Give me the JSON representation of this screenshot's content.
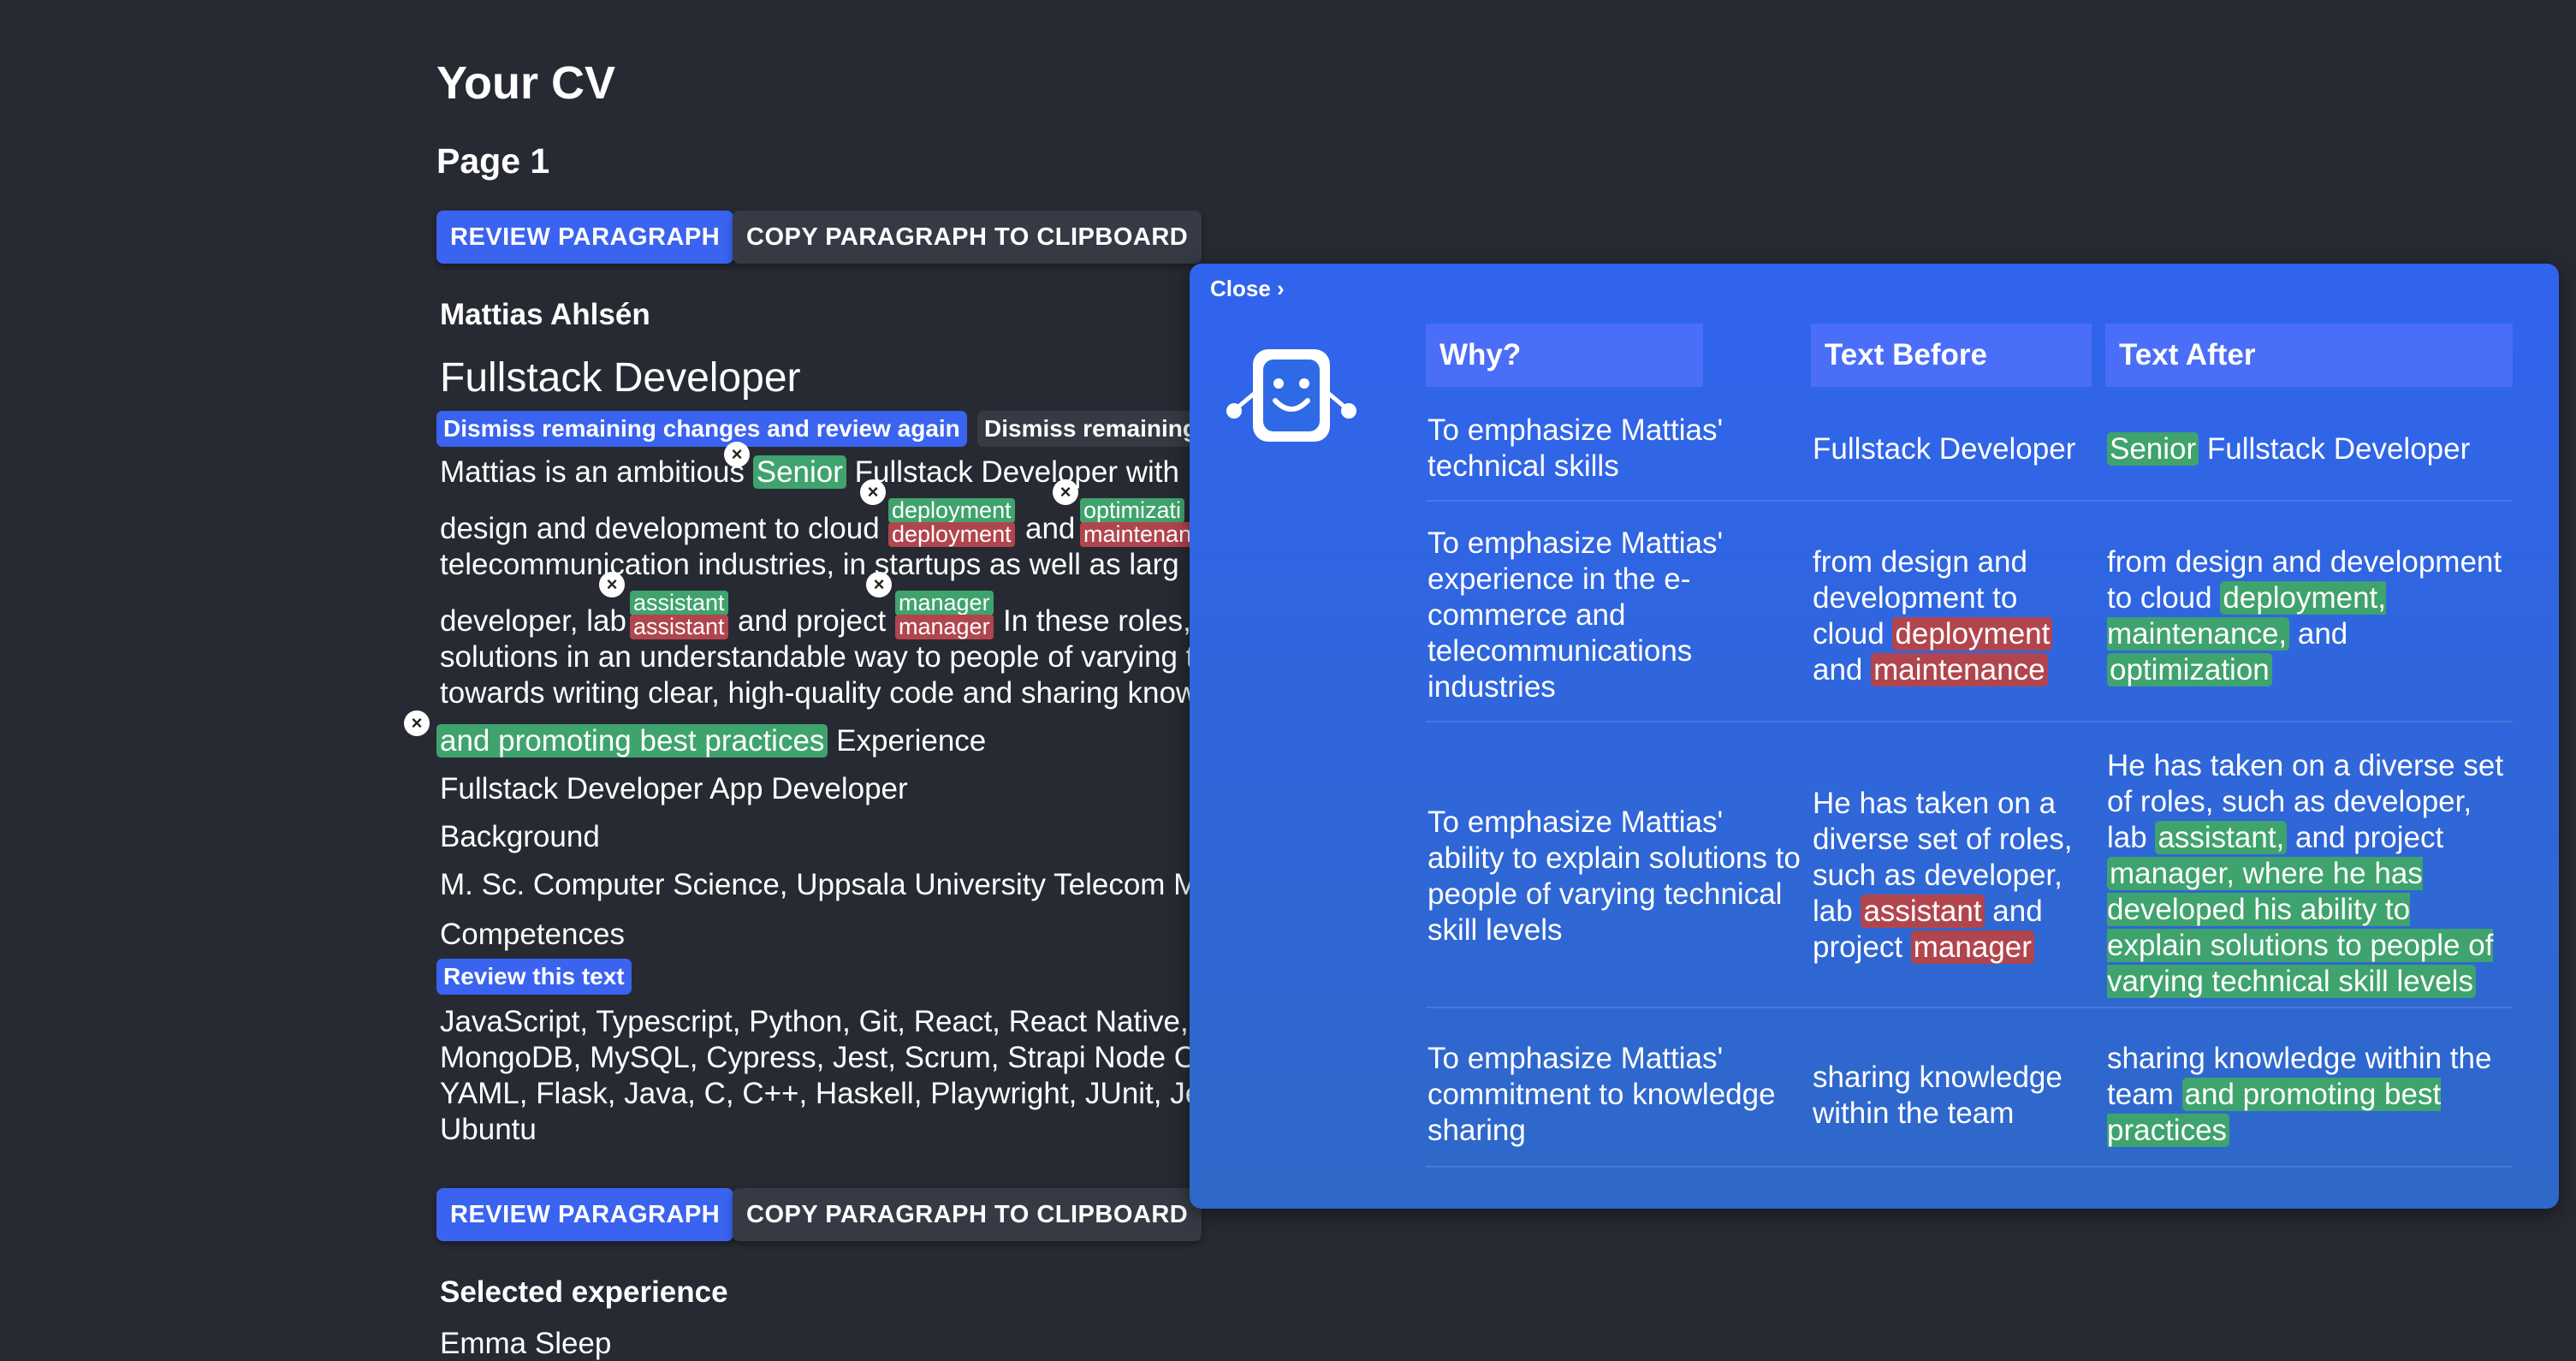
{
  "page": {
    "title": "Your CV",
    "page_label": "Page 1"
  },
  "actions": {
    "review_paragraph": "REVIEW PARAGRAPH",
    "copy_paragraph": "COPY PARAGRAPH TO CLIPBOARD"
  },
  "cv": {
    "name": "Mattias Ahlsén",
    "job_title": "Fullstack Developer",
    "dismiss_review_again": "Dismiss remaining changes and review again",
    "dismiss_remaining": "Dismiss remaining",
    "line1_a": "Mattias is an ambitious",
    "line1_senior": "Senior",
    "line1_b": "Fullstack Developer with",
    "line2_a": "design and development to cloud",
    "line2_deploy_new": "deployment",
    "line2_deploy_old": "deployment",
    "line2_and": "and",
    "line2_opt_new": "optimizati",
    "line2_opt_old": "maintenan",
    "line3": "telecommunication industries, in startups as well as larg",
    "line4_a": "developer, lab",
    "line4_assist_new": "assistant",
    "line4_assist_old": "assistant",
    "line4_b": "and project",
    "line4_mgr_new": "manager",
    "line4_mgr_old": "manager",
    "line4_c": "In these roles,",
    "line5": "solutions in an understandable way to people of varying t",
    "line6": "towards writing clear, high-quality code and sharing know",
    "line7_added": "and promoting best practices",
    "line7_b": "Experience",
    "line8": "Fullstack Developer App Developer",
    "line9": "Background",
    "line10": "M. Sc. Computer Science, Uppsala University Telecom M",
    "line11": "Competences",
    "review_this_text": "Review this text",
    "comp1": "JavaScript, Typescript, Python, Git, React, React Native, V",
    "comp2": "MongoDB, MySQL, Cypress, Jest, Scrum, Strapi Node CM",
    "comp3": "YAML, Flask, Java, C, C++, Haskell, Playwright, JUnit, Jen",
    "comp4": "Ubuntu",
    "selected_experience": "Selected experience",
    "emma": "Emma Sleep"
  },
  "panel": {
    "close": "Close",
    "headers": {
      "why": "Why?",
      "before": "Text Before",
      "after": "Text After"
    },
    "rows": [
      {
        "why": "To emphasize Mattias' technical skills",
        "before": "Fullstack Developer",
        "after_added": "Senior",
        "after_rest": " Fullstack Developer"
      },
      {
        "why": "To emphasize Mattias' experience in the e-commerce and telecommunications industries",
        "before_a": "from design and development to cloud ",
        "before_r1": "deployment",
        "before_b": " and ",
        "before_r2": "maintenance",
        "after_a": "from design and development to cloud ",
        "after_g1": "deployment, maintenance,",
        "after_b": " and ",
        "after_g2": "optimization"
      },
      {
        "why": "To emphasize Mattias' ability to explain solutions to people of varying technical skill levels",
        "before_a": "He has taken on a diverse set of roles, such as developer, lab ",
        "before_r1": "assistant",
        "before_b": " and project ",
        "before_r2": "manager",
        "after_a": "He has taken on a diverse set of roles, such as developer, lab ",
        "after_g1": "assistant,",
        "after_b": " and project ",
        "after_g2": "manager, where he has developed his ability to explain solutions to people of varying technical skill levels"
      },
      {
        "why": "To emphasize Mattias' commitment to knowledge sharing",
        "before": "sharing knowledge within the team",
        "after_a": "sharing knowledge within the team ",
        "after_g": "and promoting best practices"
      }
    ]
  },
  "colors": {
    "background": "#272a33",
    "accent_blue": "#3a63f0",
    "added_green": "#3fa36d",
    "removed_red": "#b1454d",
    "panel_blue": "#3064ee"
  }
}
